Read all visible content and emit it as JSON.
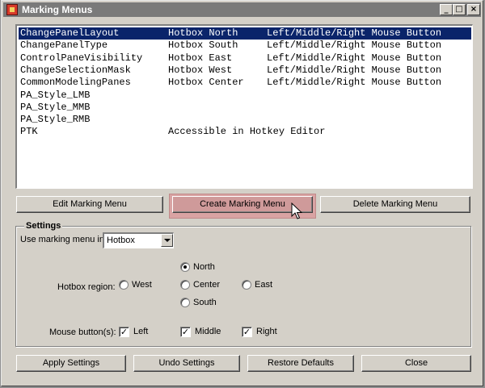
{
  "window": {
    "title": "Marking Menus",
    "controls": [
      "_",
      "□",
      "×"
    ]
  },
  "list": {
    "rows": [
      {
        "name": "ChangePanelLayout",
        "region": "Hotbox North",
        "button": "Left/Middle/Right Mouse Button",
        "selected": true
      },
      {
        "name": "ChangePanelType",
        "region": "Hotbox South",
        "button": "Left/Middle/Right Mouse Button"
      },
      {
        "name": "ControlPaneVisibility",
        "region": "Hotbox East",
        "button": "Left/Middle/Right Mouse Button"
      },
      {
        "name": "ChangeSelectionMask",
        "region": "Hotbox West",
        "button": "Left/Middle/Right Mouse Button"
      },
      {
        "name": "CommonModelingPanes",
        "region": "Hotbox Center",
        "button": "Left/Middle/Right Mouse Button"
      },
      {
        "name": "PA_Style_LMB",
        "region": "",
        "button": ""
      },
      {
        "name": "PA_Style_MMB",
        "region": "",
        "button": ""
      },
      {
        "name": "PA_Style_RMB",
        "region": "",
        "button": ""
      },
      {
        "name": "PTK",
        "region": "Accessible in Hotkey Editor",
        "button": ""
      }
    ]
  },
  "actions": {
    "edit": "Edit Marking Menu",
    "create": "Create Marking Menu",
    "delete": "Delete Marking Menu"
  },
  "settings": {
    "group_label": "Settings",
    "use_in_label": "Use marking menu in:",
    "use_in_value": "Hotbox",
    "region_label": "Hotbox region:",
    "regions": {
      "north": "North",
      "west": "West",
      "center": "Center",
      "east": "East",
      "south": "South",
      "selected": "North"
    },
    "mouse_label": "Mouse button(s):",
    "mouse": {
      "left": "Left",
      "middle": "Middle",
      "right": "Right",
      "left_checked": true,
      "middle_checked": true,
      "right_checked": true
    }
  },
  "footer": {
    "apply": "Apply Settings",
    "undo": "Undo Settings",
    "restore": "Restore Defaults",
    "close": "Close"
  },
  "colors": {
    "selection": "#0a246a",
    "highlight": "#d9a3a3"
  }
}
